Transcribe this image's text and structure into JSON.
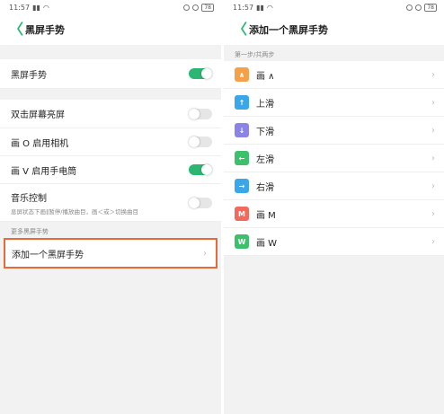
{
  "status_bar": {
    "time": "11:57",
    "battery": "78"
  },
  "left": {
    "title": "黑屏手势",
    "master_toggle": {
      "label": "黑屏手势",
      "on": true
    },
    "settings": [
      {
        "label": "双击屏幕亮屏",
        "on": false
      },
      {
        "label": "画 O 启用相机",
        "on": false
      },
      {
        "label": "画 V 启用手电筒",
        "on": true
      },
      {
        "label": "音乐控制",
        "sub": "息屏状态下画‖暂停/播放曲目，画＜或＞切换曲目",
        "on": false
      }
    ],
    "section_label": "更多黑屏手势",
    "add_label": "添加一个黑屏手势"
  },
  "right": {
    "title": "添加一个黑屏手势",
    "section_label": "第一步/共两步",
    "gestures": [
      {
        "label": "画 ∧",
        "glyph": "∧",
        "color": "#f5a14a",
        "icon": "caret-up-icon"
      },
      {
        "label": "上滑",
        "glyph": "↑",
        "color": "#3aa7e8",
        "icon": "arrow-up-icon"
      },
      {
        "label": "下滑",
        "glyph": "↓",
        "color": "#8b83e6",
        "icon": "arrow-down-icon"
      },
      {
        "label": "左滑",
        "glyph": "←",
        "color": "#3cc06b",
        "icon": "arrow-left-icon"
      },
      {
        "label": "右滑",
        "glyph": "→",
        "color": "#3aa7e8",
        "icon": "arrow-right-icon"
      },
      {
        "label": "画 M",
        "glyph": "M",
        "color": "#f06a5e",
        "icon": "letter-m-icon"
      },
      {
        "label": "画 W",
        "glyph": "W",
        "color": "#3cc06b",
        "icon": "letter-w-icon"
      }
    ]
  },
  "glyphs": {
    "back": "〈",
    "chevron": "›"
  },
  "colors": {
    "accent": "#2bb673",
    "highlight_border": "#e86a37"
  }
}
